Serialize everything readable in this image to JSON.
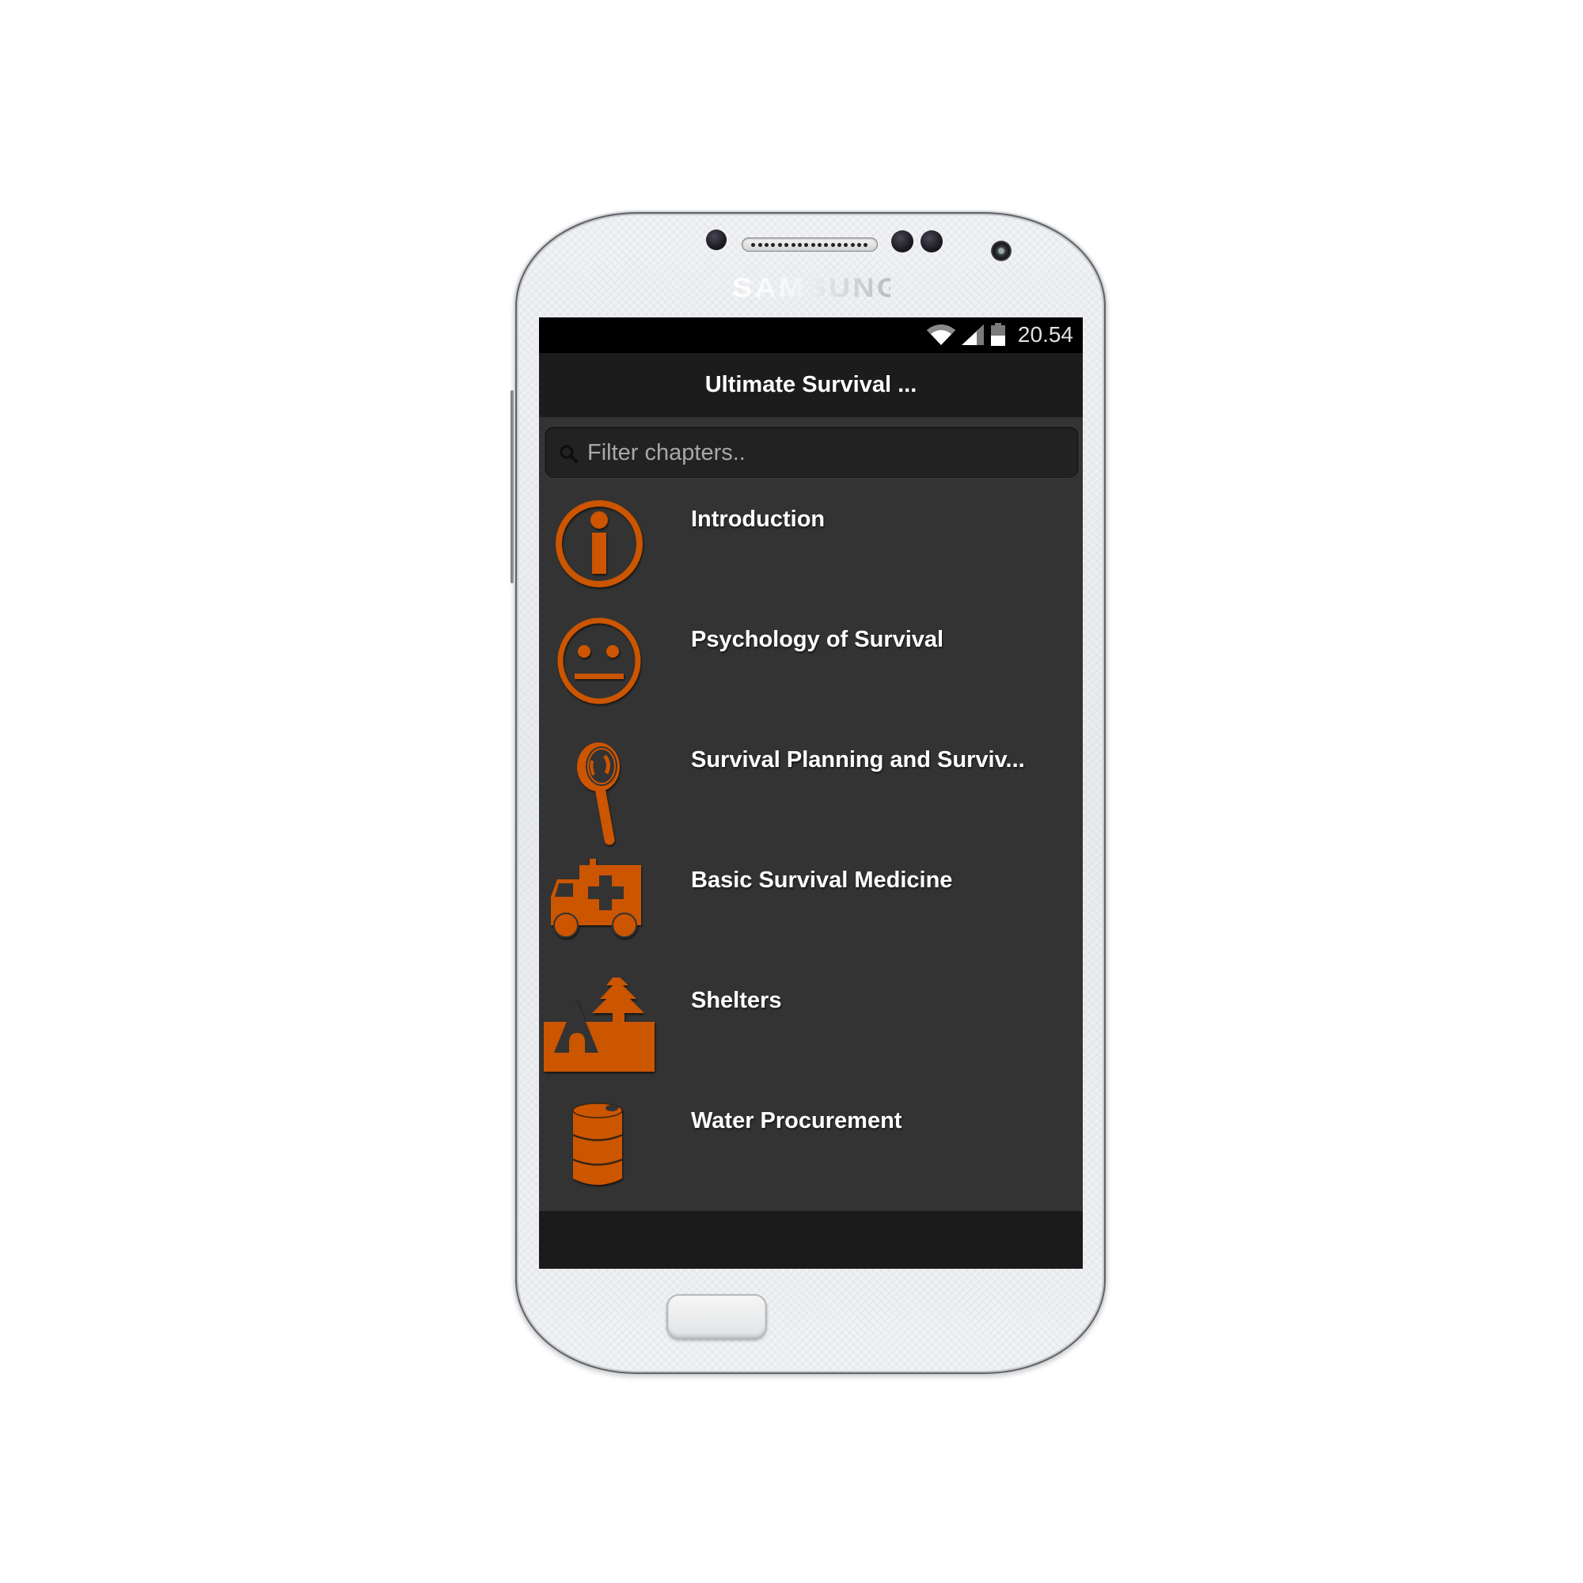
{
  "device": {
    "brand": "SAMSUNG"
  },
  "status_bar": {
    "time": "20.54",
    "icons": [
      "wifi-icon",
      "signal-icon",
      "battery-icon"
    ],
    "battery_level": 0.5
  },
  "app": {
    "title": "Ultimate Survival ..."
  },
  "search": {
    "placeholder": "Filter chapters..",
    "value": ""
  },
  "chapters": [
    {
      "label": "Introduction",
      "icon": "info-icon"
    },
    {
      "label": "Psychology of Survival",
      "icon": "neutral-face-icon"
    },
    {
      "label": "Survival Planning and Surviv...",
      "icon": "magnifier-icon"
    },
    {
      "label": "Basic Survival Medicine",
      "icon": "ambulance-icon"
    },
    {
      "label": "Shelters",
      "icon": "shelter-icon"
    },
    {
      "label": "Water Procurement",
      "icon": "barrel-icon"
    }
  ],
  "colors": {
    "accent": "#cc5500",
    "status_bar_bg": "#000000",
    "action_bar_bg": "#1c1c1c",
    "list_bg": "#333333",
    "text": "#ffffff"
  }
}
